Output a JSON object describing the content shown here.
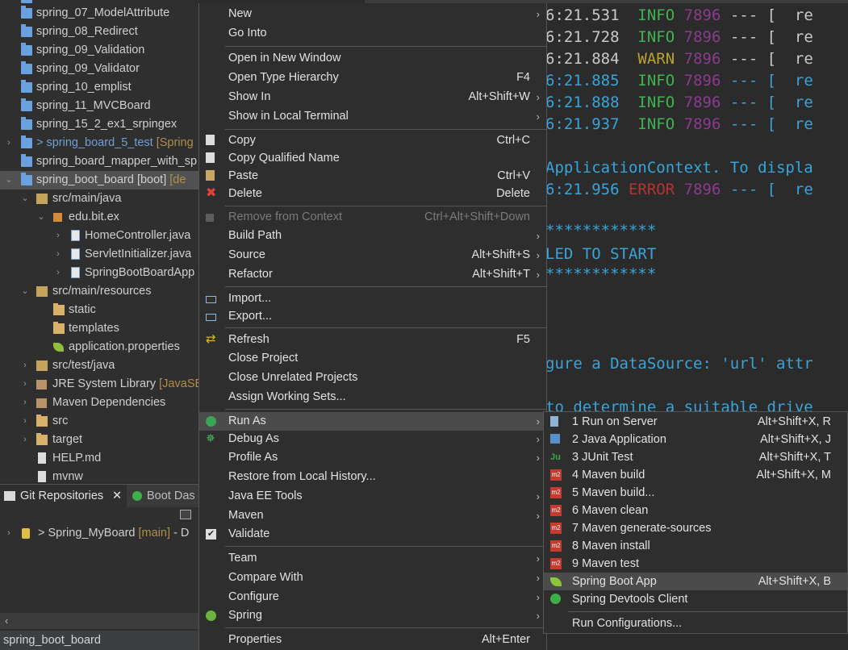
{
  "explorer": {
    "items": [
      {
        "label": "spring_07_ModelAttribute",
        "extra": ""
      },
      {
        "label": "spring_08_Redirect",
        "extra": ""
      },
      {
        "label": "spring_09_Validation",
        "extra": ""
      },
      {
        "label": "spring_09_Validator",
        "extra": ""
      },
      {
        "label": "spring_10_emplist",
        "extra": ""
      },
      {
        "label": "spring_11_MVCBoard",
        "extra": ""
      },
      {
        "label": "spring_15_2_ex1_srpingex",
        "extra": ""
      },
      {
        "label": "> spring_board_5_test",
        "extra": "[Spring"
      },
      {
        "label": "spring_board_mapper_with_sp",
        "extra": ""
      },
      {
        "label": "spring_boot_board [boot]",
        "extra": "[de"
      },
      {
        "label": "src/main/java",
        "extra": ""
      },
      {
        "label": "edu.bit.ex",
        "extra": ""
      },
      {
        "label": "HomeController.java",
        "extra": ""
      },
      {
        "label": "ServletInitializer.java",
        "extra": ""
      },
      {
        "label": "SpringBootBoardApp",
        "extra": ""
      },
      {
        "label": "src/main/resources",
        "extra": ""
      },
      {
        "label": "static",
        "extra": ""
      },
      {
        "label": "templates",
        "extra": ""
      },
      {
        "label": "application.properties",
        "extra": ""
      },
      {
        "label": "src/test/java",
        "extra": ""
      },
      {
        "label": "JRE System Library",
        "extra": "[JavaSE-"
      },
      {
        "label": "Maven Dependencies",
        "extra": ""
      },
      {
        "label": "src",
        "extra": ""
      },
      {
        "label": "target",
        "extra": ""
      },
      {
        "label": "HELP.md",
        "extra": ""
      },
      {
        "label": "mvnw",
        "extra": ""
      }
    ]
  },
  "git": {
    "tab1": "Git Repositories",
    "tab2": "Boot Das",
    "repo_label": "> Spring_MyBoard",
    "repo_branch": "[main]",
    "repo_tail": "- D"
  },
  "status_bar": {
    "text": "spring_boot_board"
  },
  "console": {
    "lines": [
      {
        "ts": "6:21.531",
        "level": "INFO",
        "pid": "7896",
        "rest": "--- [  re"
      },
      {
        "ts": "6:21.728",
        "level": "INFO",
        "pid": "7896",
        "rest": "--- [  re"
      },
      {
        "ts": "6:21.884",
        "level": "WARN",
        "pid": "7896",
        "rest": "--- [  re"
      },
      {
        "ts": "6:21.885",
        "level": "INFO",
        "pid": "7896",
        "rest": "--- [  re"
      },
      {
        "ts": "6:21.888",
        "level": "INFO",
        "pid": "7896",
        "rest": "--- [  re"
      },
      {
        "ts": "6:21.937",
        "level": "INFO",
        "pid": "7896",
        "rest": "--- [  re"
      }
    ],
    "app_context": "ApplicationContext. To displa",
    "error_line": {
      "ts": "6:21.956",
      "level": "ERROR",
      "pid": "7896",
      "rest": "--- [  re"
    },
    "stars": "************",
    "failed": "LED TO START",
    "datasource": "gure a DataSource: 'url' attr",
    "determine": "to determine a suitable drive"
  },
  "context_menu": {
    "items": [
      {
        "label": "New",
        "accel": "",
        "submenu": true
      },
      {
        "label": "Go Into",
        "accel": "",
        "submenu": false
      },
      {
        "label": "Open in New Window",
        "accel": "",
        "submenu": false
      },
      {
        "label": "Open Type Hierarchy",
        "accel": "F4",
        "submenu": false
      },
      {
        "label": "Show In",
        "accel": "Alt+Shift+W",
        "submenu": true
      },
      {
        "label": "Show in Local Terminal",
        "accel": "",
        "submenu": true
      },
      {
        "label": "Copy",
        "accel": "Ctrl+C",
        "submenu": false
      },
      {
        "label": "Copy Qualified Name",
        "accel": "",
        "submenu": false
      },
      {
        "label": "Paste",
        "accel": "Ctrl+V",
        "submenu": false
      },
      {
        "label": "Delete",
        "accel": "Delete",
        "submenu": false
      },
      {
        "label": "Remove from Context",
        "accel": "Ctrl+Alt+Shift+Down",
        "submenu": false
      },
      {
        "label": "Build Path",
        "accel": "",
        "submenu": true
      },
      {
        "label": "Source",
        "accel": "Alt+Shift+S",
        "submenu": true
      },
      {
        "label": "Refactor",
        "accel": "Alt+Shift+T",
        "submenu": true
      },
      {
        "label": "Import...",
        "accel": "",
        "submenu": false
      },
      {
        "label": "Export...",
        "accel": "",
        "submenu": false
      },
      {
        "label": "Refresh",
        "accel": "F5",
        "submenu": false
      },
      {
        "label": "Close Project",
        "accel": "",
        "submenu": false
      },
      {
        "label": "Close Unrelated Projects",
        "accel": "",
        "submenu": false
      },
      {
        "label": "Assign Working Sets...",
        "accel": "",
        "submenu": false
      },
      {
        "label": "Run As",
        "accel": "",
        "submenu": true
      },
      {
        "label": "Debug As",
        "accel": "",
        "submenu": true
      },
      {
        "label": "Profile As",
        "accel": "",
        "submenu": true
      },
      {
        "label": "Restore from Local History...",
        "accel": "",
        "submenu": false
      },
      {
        "label": "Java EE Tools",
        "accel": "",
        "submenu": true
      },
      {
        "label": "Maven",
        "accel": "",
        "submenu": true
      },
      {
        "label": "Validate",
        "accel": "",
        "submenu": false
      },
      {
        "label": "Team",
        "accel": "",
        "submenu": true
      },
      {
        "label": "Compare With",
        "accel": "",
        "submenu": true
      },
      {
        "label": "Configure",
        "accel": "",
        "submenu": true
      },
      {
        "label": "Spring",
        "accel": "",
        "submenu": true
      },
      {
        "label": "Properties",
        "accel": "Alt+Enter",
        "submenu": false
      }
    ]
  },
  "run_as_menu": {
    "items": [
      {
        "label": "1 Run on Server",
        "accel": "Alt+Shift+X, R"
      },
      {
        "label": "2 Java Application",
        "accel": "Alt+Shift+X, J"
      },
      {
        "label": "3 JUnit Test",
        "accel": "Alt+Shift+X, T"
      },
      {
        "label": "4 Maven build",
        "accel": "Alt+Shift+X, M"
      },
      {
        "label": "5 Maven build...",
        "accel": ""
      },
      {
        "label": "6 Maven clean",
        "accel": ""
      },
      {
        "label": "7 Maven generate-sources",
        "accel": ""
      },
      {
        "label": "8 Maven install",
        "accel": ""
      },
      {
        "label": "9 Maven test",
        "accel": ""
      },
      {
        "label": "Spring Boot App",
        "accel": "Alt+Shift+X, B"
      },
      {
        "label": "Spring Devtools Client",
        "accel": ""
      },
      {
        "label": "Run Configurations...",
        "accel": ""
      }
    ]
  },
  "icons": {
    "junit": "Ju",
    "maven": "m2"
  }
}
